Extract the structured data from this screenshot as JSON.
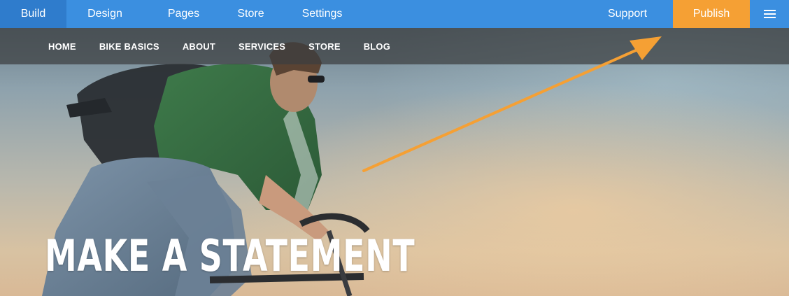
{
  "editor_bar": {
    "tabs": {
      "build": "Build",
      "design": "Design",
      "pages": "Pages",
      "store": "Store",
      "settings": "Settings"
    },
    "support": "Support",
    "publish": "Publish",
    "menu_icon": "hamburger-menu-icon",
    "active_tab": "Build",
    "colors": {
      "bar": "#3b8fe0",
      "active_tab": "#2f7ccc",
      "publish": "#f5a034"
    }
  },
  "site_nav": {
    "items": [
      "HOME",
      "BIKE BASICS",
      "ABOUT",
      "SERVICES",
      "STORE",
      "BLOG"
    ]
  },
  "hero": {
    "headline": "MAKE A STATEMENT"
  },
  "annotation": {
    "arrow_color": "#f5a034",
    "points_to": "Publish"
  }
}
